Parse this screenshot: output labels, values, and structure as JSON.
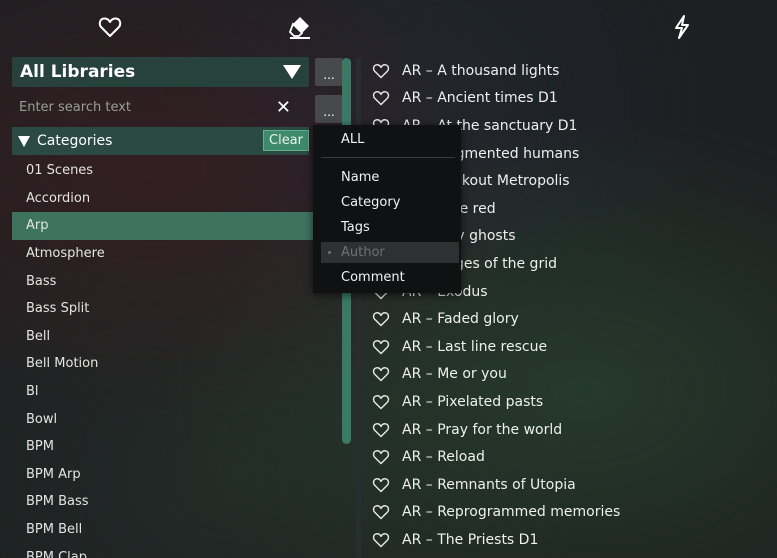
{
  "toolbar": {
    "icons": [
      "heart-icon",
      "eraser-icon",
      "lightning-icon"
    ]
  },
  "library": {
    "selected": "All Libraries",
    "more_label": "..."
  },
  "search": {
    "placeholder": "Enter search text",
    "clear_label": "✕",
    "more_label": "..."
  },
  "categories": {
    "header": "Categories",
    "clear_label": "Clear",
    "items": [
      "01 Scenes",
      "Accordion",
      "Arp",
      "Atmosphere",
      "Bass",
      "Bass Split",
      "Bell",
      "Bell Motion",
      "Bl",
      "Bowl",
      "BPM",
      "BPM Arp",
      "BPM Bass",
      "BPM Bell",
      "BPM Clap"
    ],
    "selected_index": 2
  },
  "menu": {
    "all": "ALL",
    "items": [
      "Name",
      "Category",
      "Tags",
      "Author",
      "Comment"
    ],
    "highlighted": "Author"
  },
  "presets": [
    "AR – A thousand lights",
    "AR – Ancient times D1",
    "AR – At the sanctuary D1",
    "AR – Augmented humans",
    "AR – Lookout Metropolis",
    "AR – Blue red",
    "AR – City ghosts",
    "AR – Edges of the grid",
    "AR – Exodus",
    "AR – Faded glory",
    "AR – Last line rescue",
    "AR – Me or you",
    "AR – Pixelated pasts",
    "AR – Pray for the world",
    "AR – Reload",
    "AR – Remnants of Utopia",
    "AR – Reprogrammed memories",
    "AR – The Priests D1"
  ],
  "colors": {
    "accent": "#3e735f",
    "clear_button": "#3f8a6d",
    "background": "#1d1f21"
  }
}
